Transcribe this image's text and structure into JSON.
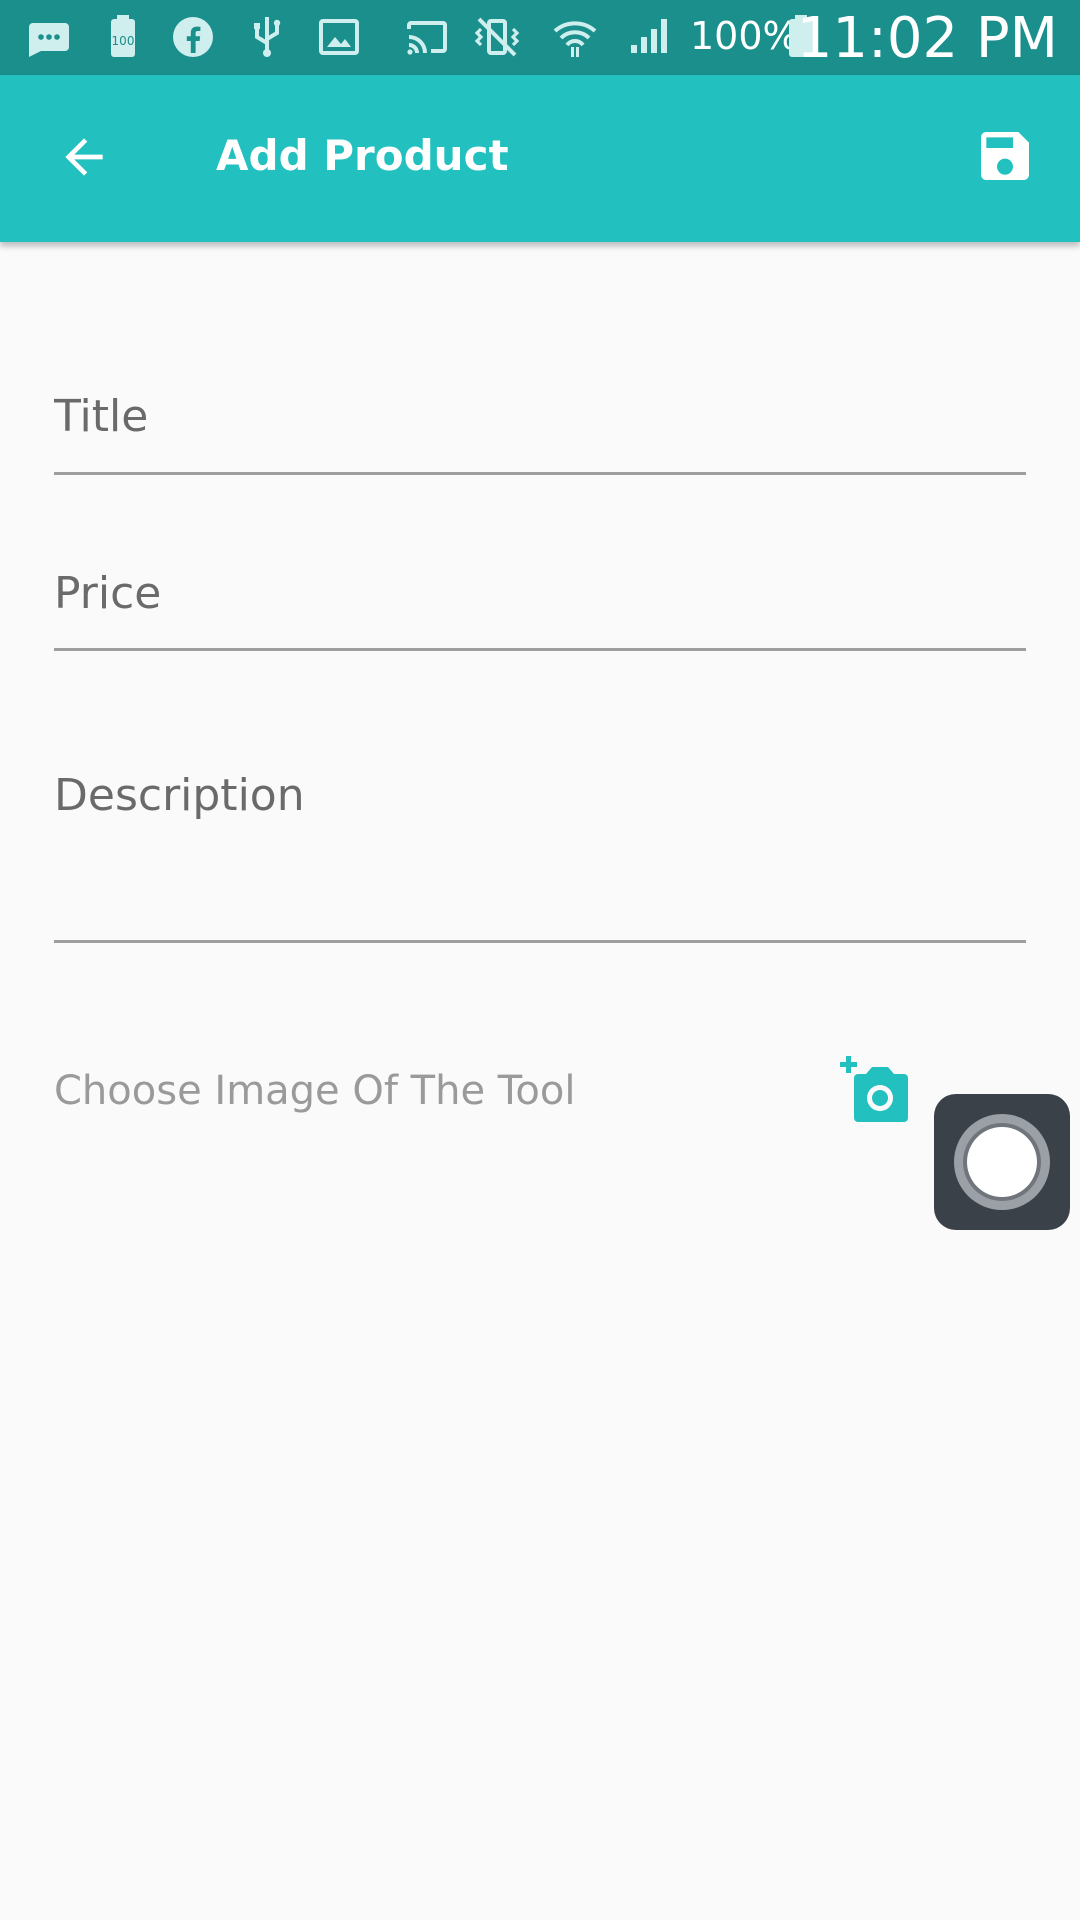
{
  "status_bar": {
    "battery_percent": "100%",
    "time": "11:02 PM",
    "icons": [
      "message-icon",
      "battery-saver-icon",
      "facebook-icon",
      "usb-icon",
      "image-icon",
      "cast-icon",
      "vibrate-mute-icon",
      "wifi-icon",
      "signal-icon",
      "battery-icon"
    ]
  },
  "app_bar": {
    "title": "Add Product",
    "back_icon": "arrow-back-icon",
    "save_icon": "save-icon",
    "color": "#22c0bf"
  },
  "form": {
    "title_placeholder": "Title",
    "title_value": "",
    "price_placeholder": "Price",
    "price_value": "",
    "description_placeholder": "Description",
    "description_value": "",
    "choose_image_label": "Choose Image Of The Tool",
    "add_photo_icon": "add-a-photo-icon"
  },
  "overlay": {
    "assistive_touch_icon": "assistive-touch-icon"
  }
}
